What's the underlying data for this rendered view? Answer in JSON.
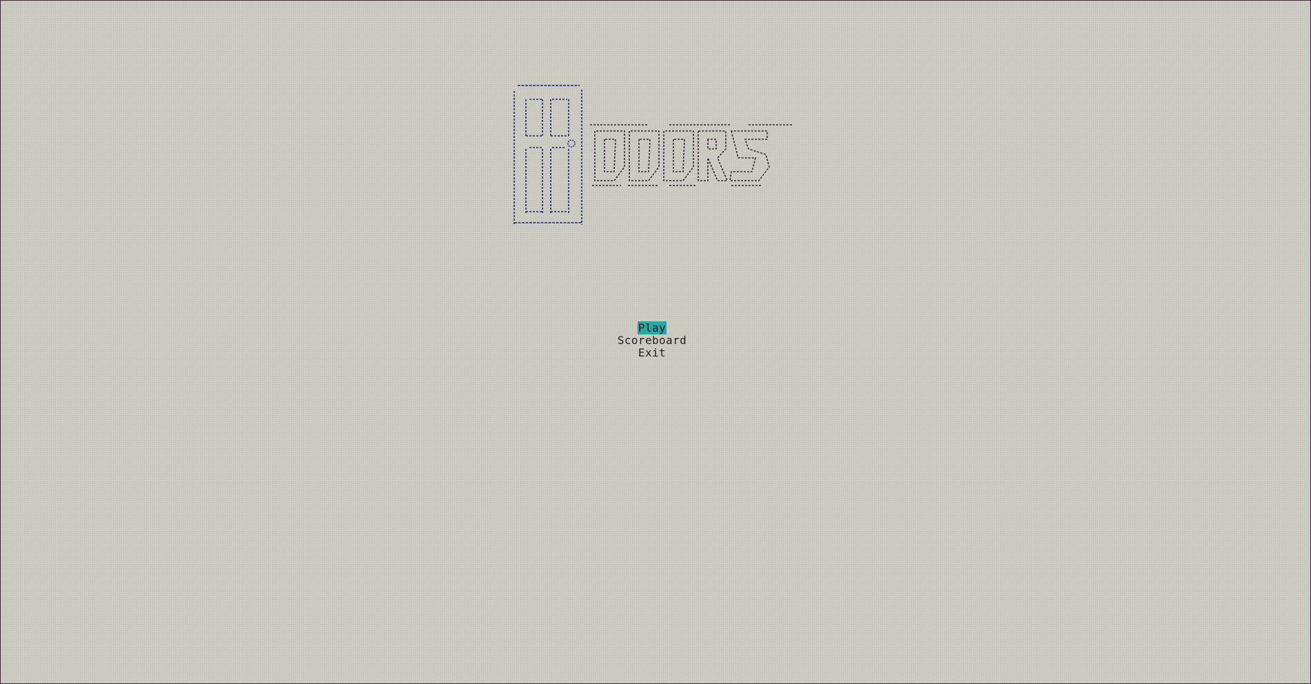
{
  "game": {
    "logo_alt": "DOORS",
    "colors": {
      "background": "#cbcbc3",
      "selection_highlight": "#2aa6a4",
      "logo_door": "#1e2a6e",
      "logo_letters": "#3a2436",
      "text": "#1e1e1e"
    }
  },
  "menu": {
    "items": [
      {
        "label": "Play",
        "selected": true
      },
      {
        "label": "Scoreboard",
        "selected": false
      },
      {
        "label": "Exit",
        "selected": false
      }
    ]
  }
}
